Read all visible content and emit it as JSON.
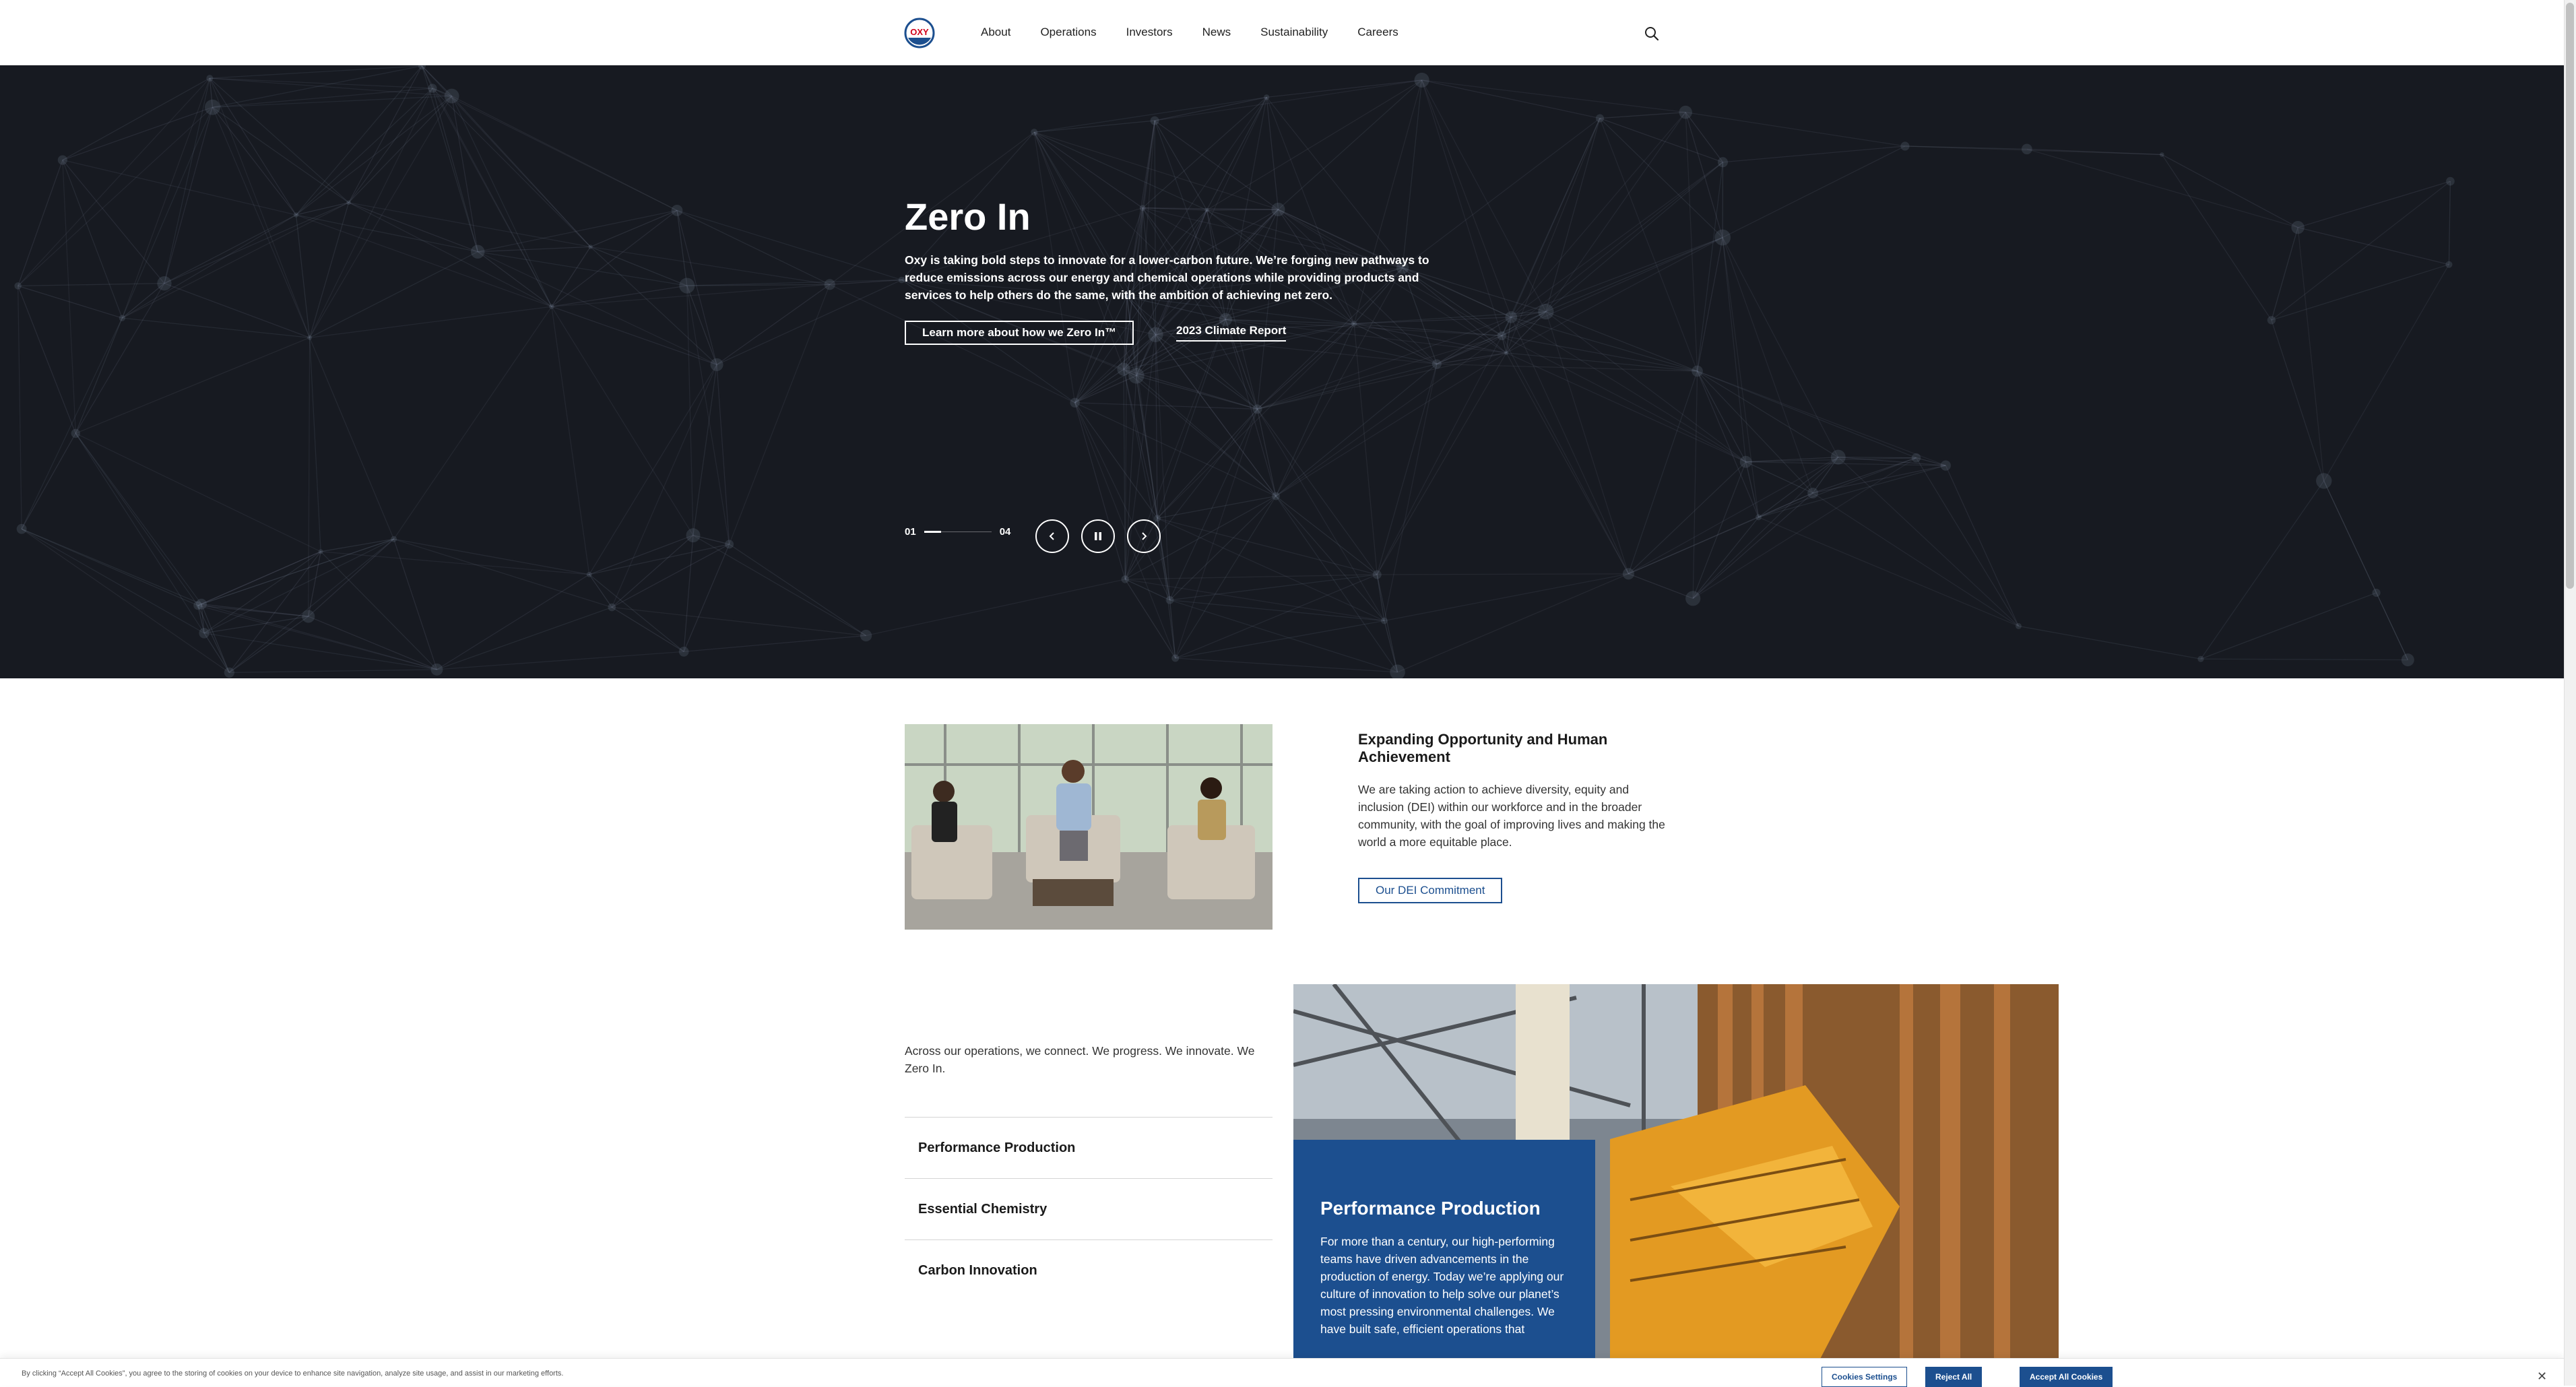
{
  "header": {
    "logo_text": "OXY",
    "nav": [
      "About",
      "Operations",
      "Investors",
      "News",
      "Sustainability",
      "Careers"
    ]
  },
  "hero": {
    "title": "Zero In",
    "description": "Oxy is taking bold steps to innovate for a lower-carbon future. We’re forging new pathways to reduce emissions across our energy and chemical operations while providing products and services to help others do the same, with the ambition of achieving net zero.",
    "primary_cta": "Learn more about how we Zero In™",
    "secondary_link": "2023 Climate Report",
    "slide_current": "01",
    "slide_total": "04",
    "slide_progress": 0.25
  },
  "dei": {
    "title": "Expanding Opportunity and Human Achievement",
    "text": "We are taking action to achieve diversity, equity and inclusion (DEI) within our workforce and in the broader community, with the goal of improving lives and making the world a more equitable place.",
    "cta": "Our DEI Commitment"
  },
  "operations": {
    "intro": "Across our operations, we connect. We progress. We innovate. We Zero In.",
    "items": [
      "Performance Production",
      "Essential Chemistry",
      "Carbon Innovation"
    ],
    "card_title": "Performance Production",
    "card_text": "For more than a century, our high-performing teams have driven advancements in the production of energy. Today we’re applying our culture of innovation to help solve our planet’s most pressing environmental challenges. We have built safe, efficient operations that"
  },
  "cookie": {
    "text": "By clicking “Accept All Cookies”, you agree to the storing of cookies on your device to enhance site navigation, analyze site usage, and assist in our marketing efforts.",
    "settings": "Cookies Settings",
    "reject": "Reject All",
    "accept": "Accept All Cookies"
  },
  "colors": {
    "brand_blue": "#1c4f8f",
    "hero_bg": "#171a21",
    "logo_red": "#d0021b"
  }
}
